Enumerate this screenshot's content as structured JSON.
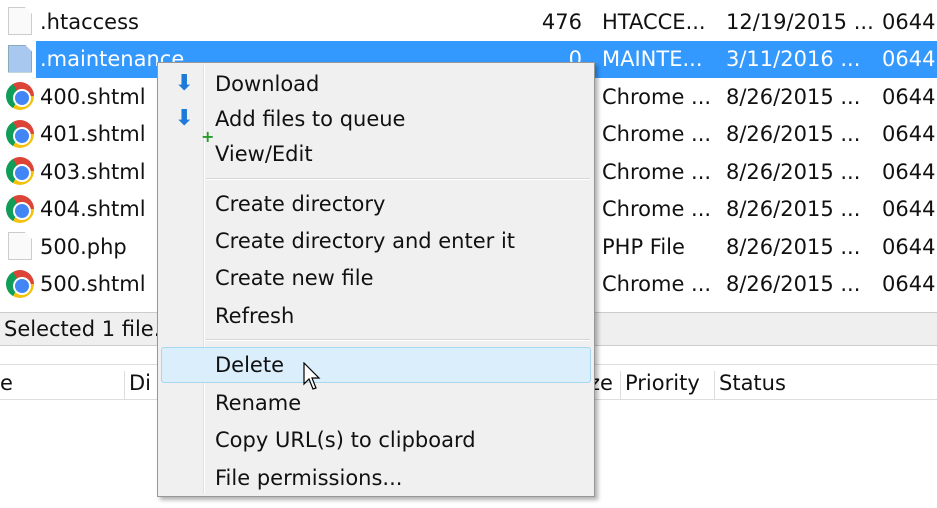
{
  "files": [
    {
      "name": ".htaccess",
      "size": "476",
      "type": "HTACCE...",
      "date": "12/19/2015 ...",
      "perm": "0644",
      "icon": "file-icon",
      "selected": false
    },
    {
      "name": ".maintenance",
      "size": "0",
      "type": "MAINTE...",
      "date": "3/11/2016 ...",
      "perm": "0644",
      "icon": "file-icon",
      "selected": true
    },
    {
      "name": "400.shtml",
      "size": "",
      "type": "Chrome ...",
      "date": "8/26/2015 ...",
      "perm": "0644",
      "icon": "chrome-icon",
      "selected": false
    },
    {
      "name": "401.shtml",
      "size": "",
      "type": "Chrome ...",
      "date": "8/26/2015 ...",
      "perm": "0644",
      "icon": "chrome-icon",
      "selected": false
    },
    {
      "name": "403.shtml",
      "size": "",
      "type": "Chrome ...",
      "date": "8/26/2015 ...",
      "perm": "0644",
      "icon": "chrome-icon",
      "selected": false
    },
    {
      "name": "404.shtml",
      "size": "",
      "type": "Chrome ...",
      "date": "8/26/2015 ...",
      "perm": "0644",
      "icon": "chrome-icon",
      "selected": false
    },
    {
      "name": "500.php",
      "size": "",
      "type": "PHP File",
      "date": "8/26/2015 ...",
      "perm": "0644",
      "icon": "file-icon",
      "selected": false
    },
    {
      "name": "500.shtml",
      "size": "",
      "type": "Chrome ...",
      "date": "8/26/2015 ...",
      "perm": "0644",
      "icon": "chrome-icon",
      "selected": false
    }
  ],
  "status": "Selected 1 file.",
  "queue_headers": [
    "e",
    "Di",
    "ze",
    "Priority",
    "Status"
  ],
  "menu": {
    "download": "Download",
    "add_queue": "Add files to queue",
    "view_edit": "View/Edit",
    "create_dir": "Create directory",
    "create_dir_enter": "Create directory and enter it",
    "create_file": "Create new file",
    "refresh": "Refresh",
    "delete": "Delete",
    "rename": "Rename",
    "copy_url": "Copy URL(s) to clipboard",
    "permissions": "File permissions..."
  },
  "colors": {
    "selection": "#3399ff",
    "menu_highlight": "#dbeefb"
  }
}
